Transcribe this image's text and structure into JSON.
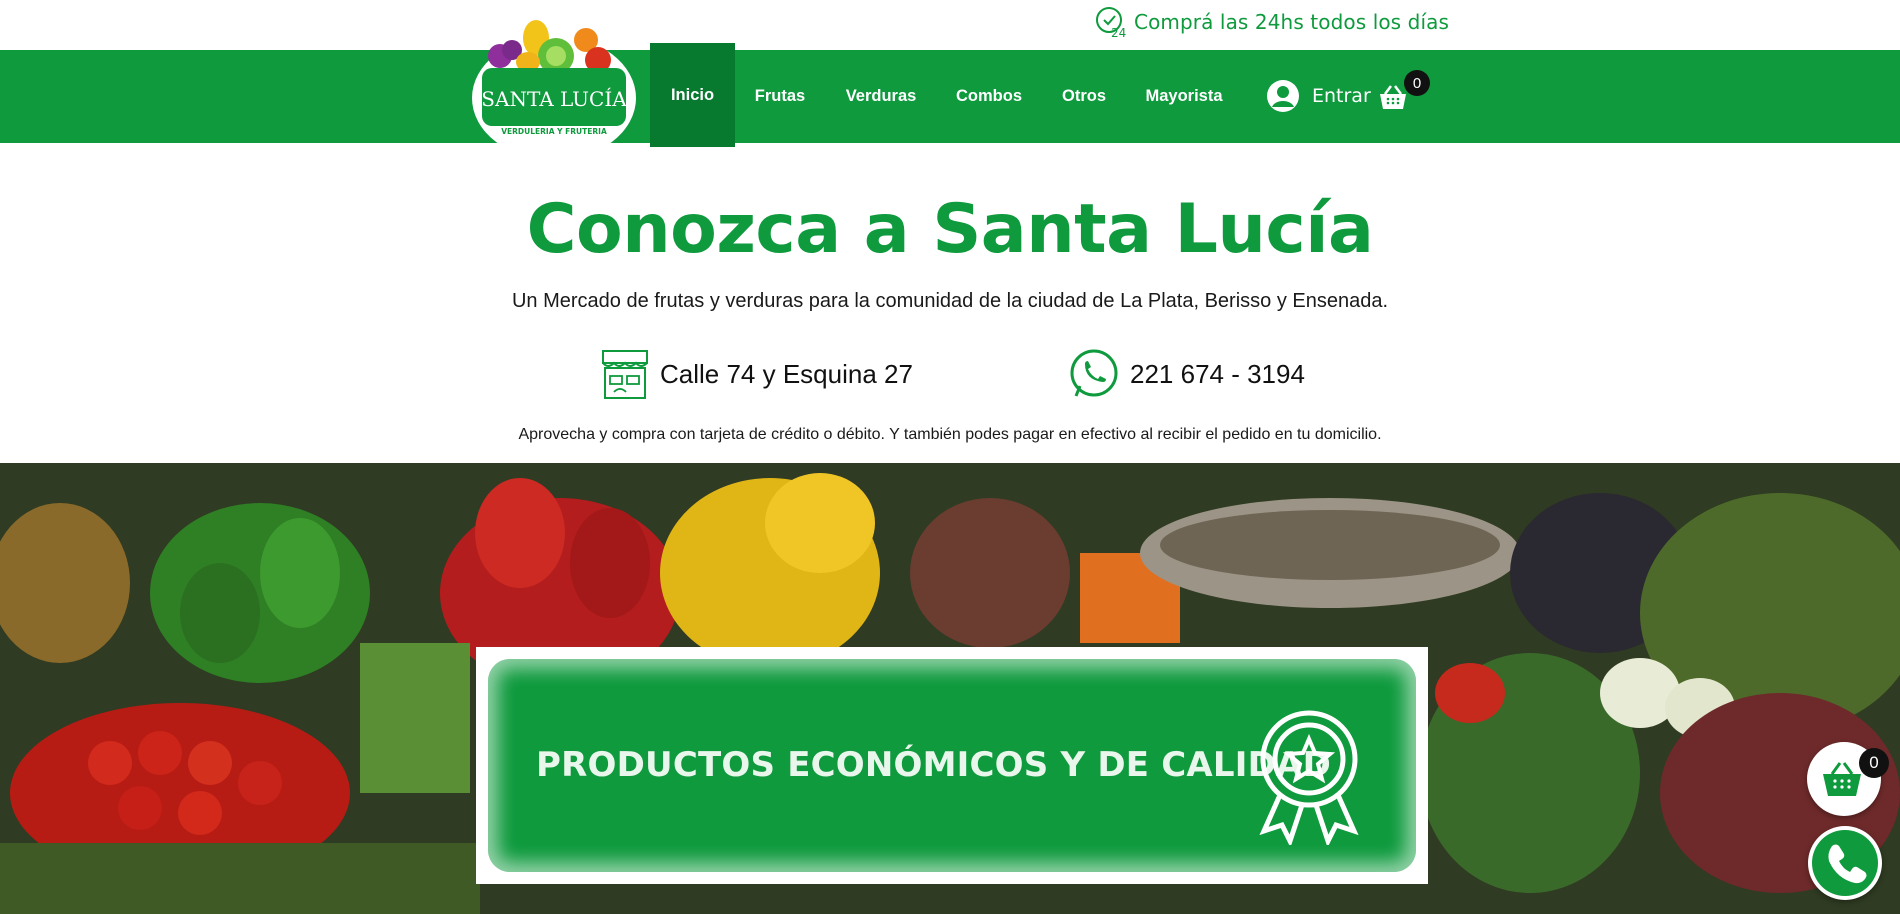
{
  "promo": {
    "text": "Comprá las 24hs todos los días",
    "icon": "clock-24h-icon"
  },
  "brand": {
    "name": "SANTA LUCÍA",
    "tagline": "VERDULERIA Y FRUTERIA"
  },
  "nav": {
    "items": [
      {
        "label": "Inicio",
        "active": true
      },
      {
        "label": "Frutas"
      },
      {
        "label": "Verduras"
      },
      {
        "label": "Combos"
      },
      {
        "label": "Otros"
      },
      {
        "label": "Mayorista"
      }
    ],
    "login_label": "Entrar",
    "cart_count": "0"
  },
  "hero": {
    "title": "Conozca a Santa Lucía",
    "subtitle": "Un Mercado de frutas y verduras para la comunidad de la ciudad de La Plata, Berisso y Ensenada.",
    "address": "Calle 74 y Esquina 27",
    "phone": "221 674 - 3194",
    "payment_note": "Aprovecha y compra con tarjeta de crédito o débito. Y también podes pagar en efectivo al recibir el pedido en tu domicilio."
  },
  "banner": {
    "text": "PRODUCTOS ECONÓMICOS Y DE CALIDAD",
    "icon": "quality-award-icon"
  },
  "floating": {
    "cart_count": "0"
  },
  "colors": {
    "brand_green": "#0e9a3d",
    "active_nav": "#077a2f",
    "badge_black": "#111111"
  }
}
